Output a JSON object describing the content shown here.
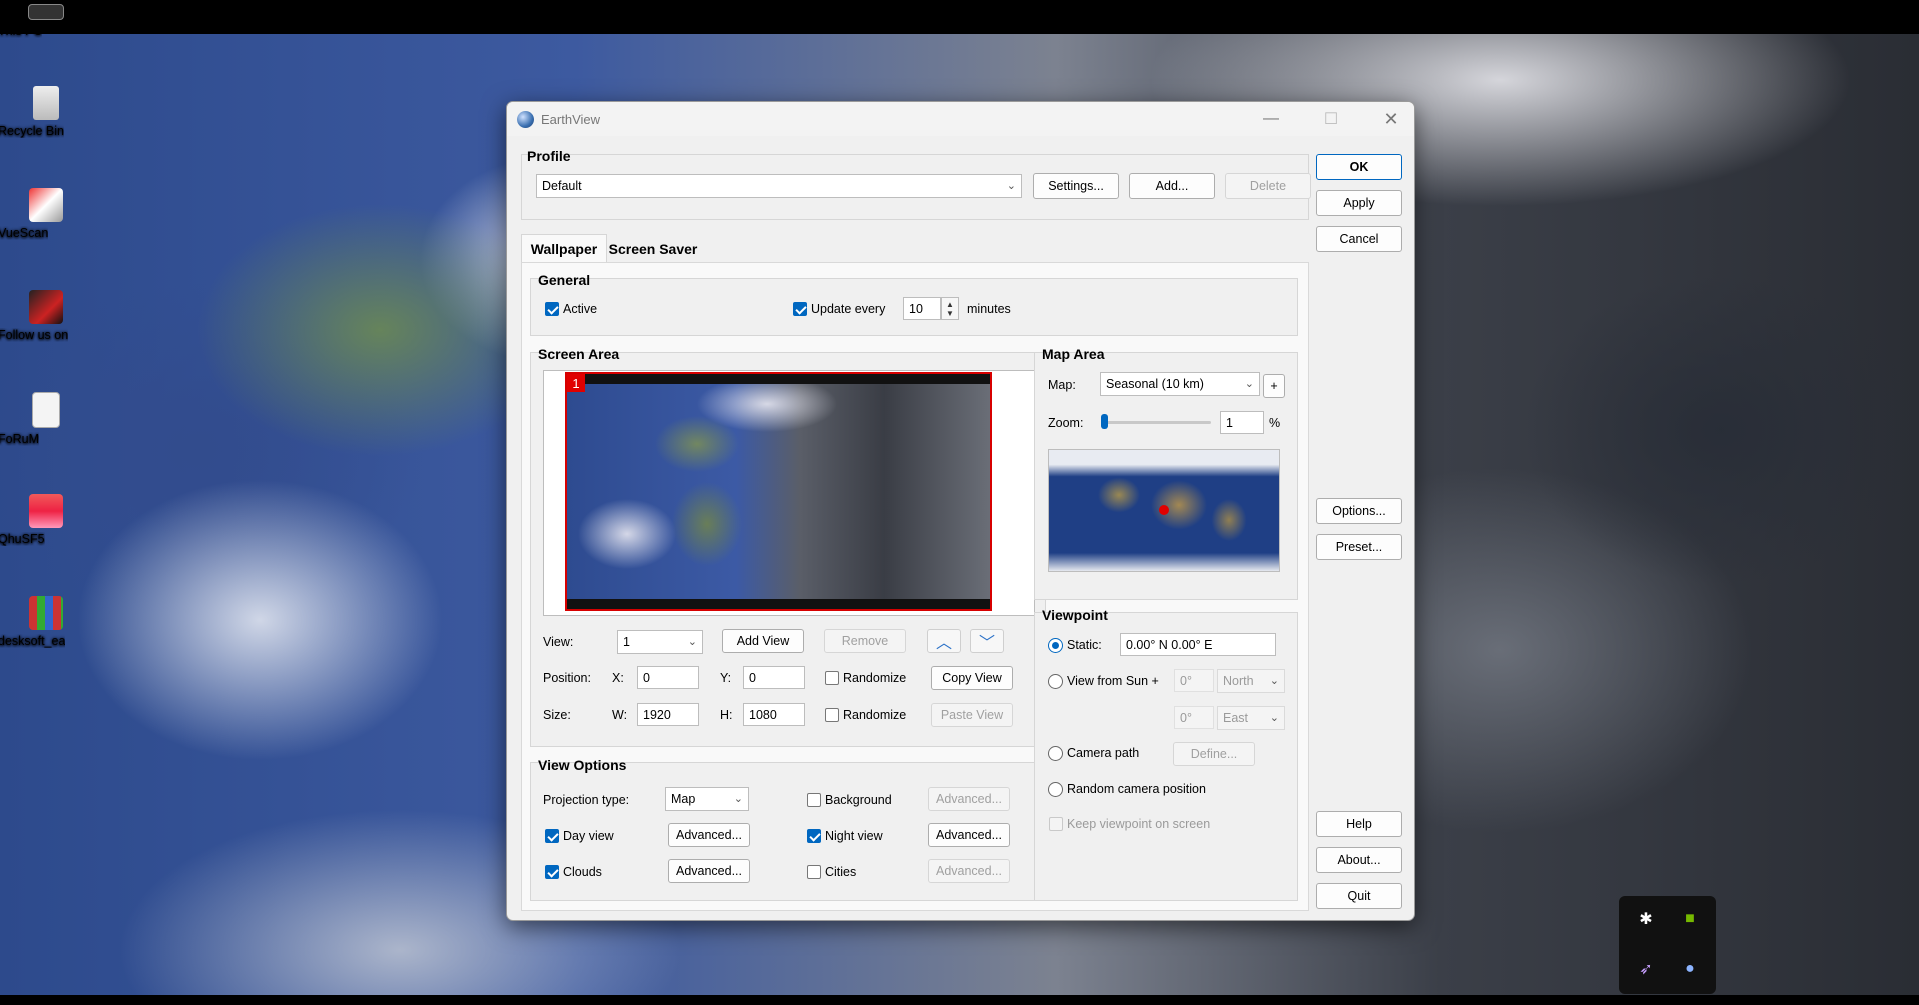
{
  "desktop": {
    "icons": [
      {
        "label": "This PC"
      },
      {
        "label": "Recycle Bin"
      },
      {
        "label": "VueScan"
      },
      {
        "label": "Follow us on"
      },
      {
        "label": "FoRuM"
      },
      {
        "label": "QhuSF5"
      },
      {
        "label": "desksoft_ea"
      }
    ]
  },
  "window": {
    "title": "EarthView",
    "controls": {
      "minimize": "—",
      "maximize": "☐",
      "close": "✕"
    }
  },
  "profile": {
    "title": "Profile",
    "selected": "Default",
    "settings_label": "Settings...",
    "add_label": "Add...",
    "delete_label": "Delete"
  },
  "side_buttons": {
    "ok": "OK",
    "apply": "Apply",
    "cancel": "Cancel",
    "options": "Options...",
    "preset": "Preset...",
    "help": "Help",
    "about": "About...",
    "quit": "Quit"
  },
  "tabs": [
    {
      "label": "Wallpaper",
      "active": true
    },
    {
      "label": "Screen Saver",
      "active": false
    }
  ],
  "general": {
    "title": "General",
    "active_label": "Active",
    "active_checked": true,
    "update_label": "Update every",
    "update_checked": true,
    "update_value": "10",
    "update_unit": "minutes"
  },
  "screen_area": {
    "title": "Screen Area",
    "badge": "1",
    "view_label": "View:",
    "view_value": "1",
    "add_view": "Add View",
    "remove": "Remove",
    "position_label": "Position:",
    "x_label": "X:",
    "x_value": "0",
    "y_label": "Y:",
    "y_value": "0",
    "randomize_label": "Randomize",
    "copy_view": "Copy View",
    "size_label": "Size:",
    "w_label": "W:",
    "w_value": "1920",
    "h_label": "H:",
    "h_value": "1080",
    "randomize2_label": "Randomize",
    "paste_view": "Paste View"
  },
  "view_options": {
    "title": "View Options",
    "projection_label": "Projection type:",
    "projection_value": "Map",
    "background_label": "Background",
    "background_checked": false,
    "advanced": "Advanced...",
    "day_view_label": "Day view",
    "day_view_checked": true,
    "night_view_label": "Night view",
    "night_view_checked": true,
    "clouds_label": "Clouds",
    "clouds_checked": true,
    "cities_label": "Cities",
    "cities_checked": false
  },
  "map_area": {
    "title": "Map Area",
    "map_label": "Map:",
    "map_value": "Seasonal (10 km)",
    "plus": "+",
    "zoom_label": "Zoom:",
    "zoom_value": "1",
    "zoom_unit": "%"
  },
  "viewpoint": {
    "title": "Viewpoint",
    "static_label": "Static:",
    "static_value": "0.00° N  0.00° E",
    "sun_label": "View from Sun +",
    "sun_deg1": "0°",
    "sun_dir1": "North",
    "sun_deg2": "0°",
    "sun_dir2": "East",
    "camera_label": "Camera path",
    "define_label": "Define...",
    "random_label": "Random camera position",
    "keep_label": "Keep viewpoint on screen"
  },
  "colors": {
    "accent": "#0067c0",
    "view_border": "#d70000"
  }
}
